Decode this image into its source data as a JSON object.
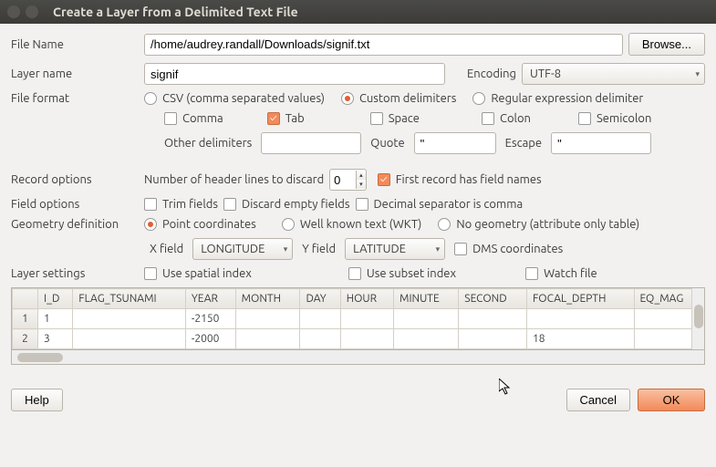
{
  "window": {
    "title": "Create a Layer from a Delimited Text File"
  },
  "filename": {
    "label": "File Name",
    "value": "/home/audrey.randall/Downloads/signif.txt",
    "browse": "Browse..."
  },
  "layername": {
    "label": "Layer name",
    "value": "signif",
    "encoding_label": "Encoding",
    "encoding_value": "UTF-8"
  },
  "fileformat": {
    "label": "File format",
    "csv": "CSV (comma separated values)",
    "custom": "Custom delimiters",
    "regex": "Regular expression delimiter",
    "comma": "Comma",
    "tab": "Tab",
    "space": "Space",
    "colon": "Colon",
    "semicolon": "Semicolon",
    "other_label": "Other delimiters",
    "other_value": "",
    "quote_label": "Quote",
    "quote_value": "\"",
    "escape_label": "Escape",
    "escape_value": "\""
  },
  "record": {
    "label": "Record options",
    "discard_label": "Number of header lines to discard",
    "discard_value": "0",
    "first_record": "First record has field names"
  },
  "field": {
    "label": "Field options",
    "trim": "Trim fields",
    "discard_empty": "Discard empty fields",
    "decimal": "Decimal separator is comma"
  },
  "geometry": {
    "label": "Geometry definition",
    "point": "Point coordinates",
    "wkt": "Well known text (WKT)",
    "none": "No geometry (attribute only table)",
    "xfield_label": "X field",
    "xfield_value": "LONGITUDE",
    "yfield_label": "Y field",
    "yfield_value": "LATITUDE",
    "dms": "DMS coordinates"
  },
  "layer_settings": {
    "label": "Layer settings",
    "spatial": "Use spatial index",
    "subset": "Use subset index",
    "watch": "Watch file"
  },
  "table": {
    "headers": [
      "I_D",
      "FLAG_TSUNAMI",
      "YEAR",
      "MONTH",
      "DAY",
      "HOUR",
      "MINUTE",
      "SECOND",
      "FOCAL_DEPTH",
      "EQ_MAG"
    ],
    "rows": [
      {
        "n": "1",
        "cells": [
          "1",
          "",
          "-2150",
          "",
          "",
          "",
          "",
          "",
          "",
          ""
        ]
      },
      {
        "n": "2",
        "cells": [
          "3",
          "",
          "-2000",
          "",
          "",
          "",
          "",
          "",
          "18",
          ""
        ]
      }
    ]
  },
  "footer": {
    "help": "Help",
    "cancel": "Cancel",
    "ok": "OK"
  }
}
